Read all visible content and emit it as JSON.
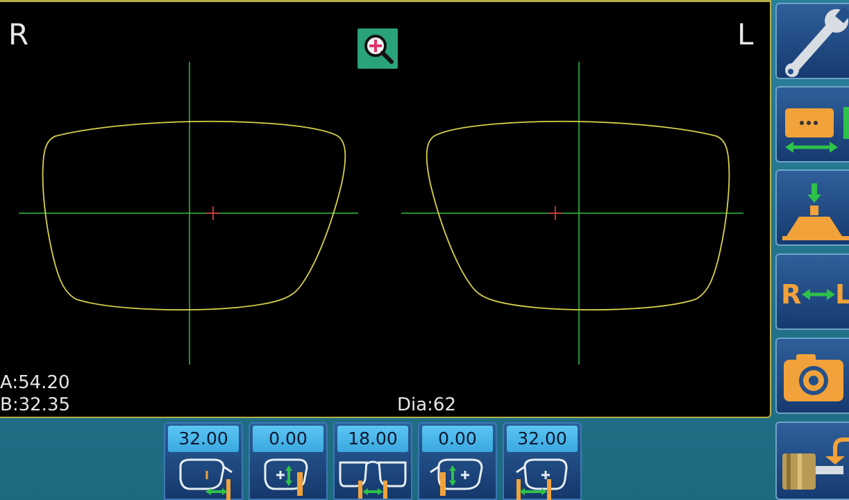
{
  "display": {
    "side_right": "R",
    "side_left": "L",
    "readout_a": "A:54.20",
    "readout_b": "B:32.35",
    "readout_dia": "Dia:62",
    "zoom_icon": "zoom-in-icon",
    "colors": {
      "background": "#000000",
      "trace": "#d9d24a",
      "crosshair": "#2fbf3f",
      "center_mark": "#d23a3a",
      "frame_border": "#b7b04a"
    }
  },
  "sidebar": {
    "items": [
      {
        "icon": "wrench-icon"
      },
      {
        "icon": "frame-width-icon"
      },
      {
        "icon": "block-press-icon"
      },
      {
        "icon": "swap-eye-icon",
        "label_r": "R",
        "label_l": "L"
      },
      {
        "icon": "camera-icon"
      },
      {
        "icon": "drill-icon"
      }
    ]
  },
  "params": [
    {
      "value": "32.00",
      "icon": "temple-distance-icon"
    },
    {
      "value": "0.00",
      "icon": "nasal-offset-icon"
    },
    {
      "value": "18.00",
      "icon": "bridge-width-icon"
    },
    {
      "value": "0.00",
      "icon": "temporal-offset-icon"
    },
    {
      "value": "32.00",
      "icon": "temple-distance-right-icon"
    }
  ]
}
